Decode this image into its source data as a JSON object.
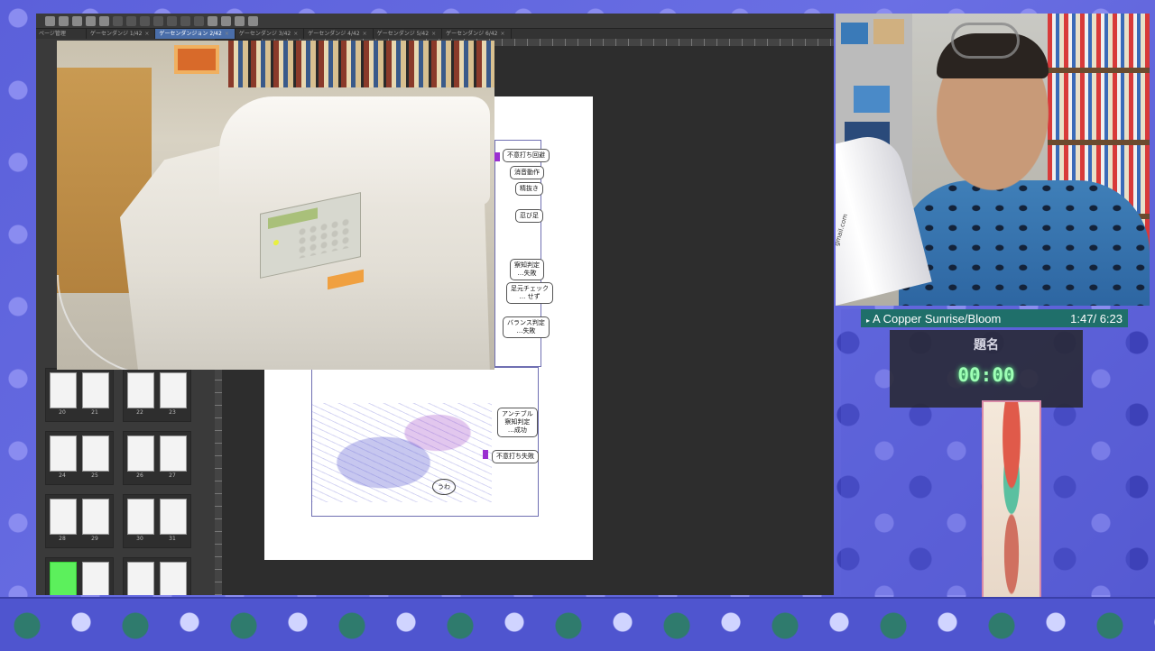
{
  "app": {
    "side_tab": "ページ管理",
    "tabs": [
      {
        "label": "ゲーセンダンジ 1/42",
        "active": false
      },
      {
        "label": "ゲーセンダンジョン 2/42",
        "active": true
      },
      {
        "label": "ゲーセンダンジ 3/42",
        "active": false
      },
      {
        "label": "ゲーセンダンジ 4/42",
        "active": false
      },
      {
        "label": "ゲーセンダンジ 5/42",
        "active": false
      },
      {
        "label": "ゲーセンダンジ 6/42",
        "active": false
      }
    ],
    "tab_close_glyph": "×",
    "page_numbers": [
      [
        "20",
        "21",
        "22",
        "23"
      ],
      [
        "24",
        "25",
        "26",
        "27"
      ],
      [
        "28",
        "29",
        "30",
        "31"
      ]
    ]
  },
  "manga": {
    "balloons": [
      "不意打ち回避",
      "消音動作",
      "精抜き",
      "忍び足",
      "察知判定\n…失敗",
      "足元チェック\n… せず",
      "バランス判定\n…失敗",
      "アンテブル\n察知判定\n…成功",
      "不意打ち失敗"
    ],
    "sfx": "うわ"
  },
  "webcam": {
    "bottle_text": "gmail.com"
  },
  "music": {
    "title": "A Copper Sunrise/Bloom",
    "time": "1:47/ 6:23"
  },
  "timer": {
    "title": "題名",
    "value": "00:00"
  },
  "colors": {
    "accent_teal": "#1f6f6a",
    "timer_green": "#9dffb5",
    "active_tab": "#4a6ea9",
    "backdrop": "#5a5fd6"
  }
}
